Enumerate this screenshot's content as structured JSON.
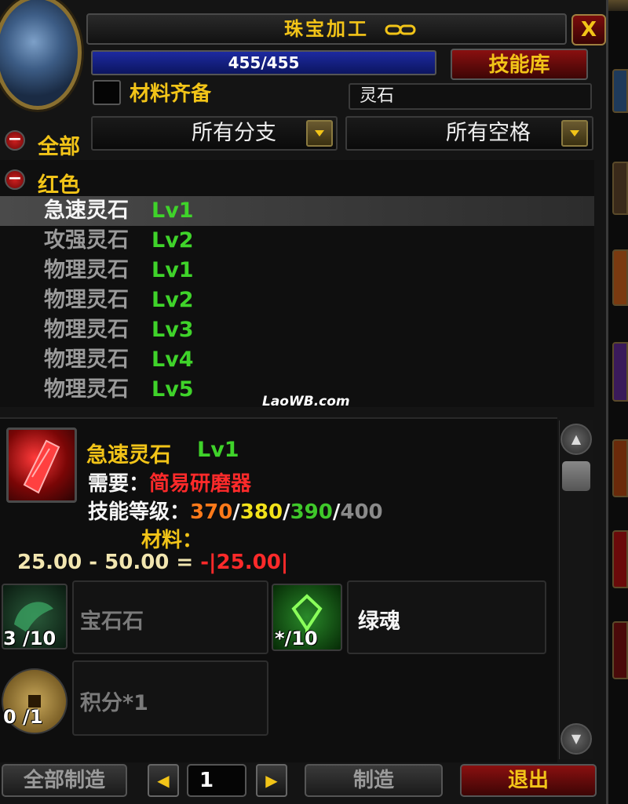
{
  "window": {
    "title": "珠宝加工",
    "close_label": "X",
    "skill_progress_text": "455/455",
    "skill_progress_fraction": 1.0,
    "skill_library_label": "技能库"
  },
  "filters": {
    "have_materials_label": "材料齐备",
    "search_value": "灵石",
    "subclass_dropdown": "所有分支",
    "slot_dropdown": "所有空格"
  },
  "list": {
    "categories": [
      {
        "label": "全部",
        "collapse_icon": "minus-icon"
      },
      {
        "label": "红色",
        "collapse_icon": "minus-icon"
      }
    ],
    "recipes": [
      {
        "name": "急速灵石",
        "lv": "Lv1",
        "name_color": "#f5f5f5",
        "selected": true
      },
      {
        "name": "攻强灵石",
        "lv": "Lv2",
        "name_color": "#9a9a9a",
        "selected": false
      },
      {
        "name": "物理灵石",
        "lv": "Lv1",
        "name_color": "#9a9a9a",
        "selected": false
      },
      {
        "name": "物理灵石",
        "lv": "Lv2",
        "name_color": "#9a9a9a",
        "selected": false
      },
      {
        "name": "物理灵石",
        "lv": "Lv3",
        "name_color": "#9a9a9a",
        "selected": false
      },
      {
        "name": "物理灵石",
        "lv": "Lv4",
        "name_color": "#9a9a9a",
        "selected": false
      },
      {
        "name": "物理灵石",
        "lv": "Lv5",
        "name_color": "#9a9a9a",
        "selected": false
      }
    ]
  },
  "watermark": "LaoWB.com",
  "detail": {
    "item_name": "急速灵石",
    "item_lv": "Lv1",
    "requires_label": "需要：",
    "requires_value": "简易研磨器",
    "skill_level_label": "技能等级：",
    "skill_levels": [
      "370",
      "380",
      "390",
      "400"
    ],
    "skill_level_colors": [
      "#ff7a1a",
      "#f2e21a",
      "#3fc82a",
      "#8a8a8a"
    ],
    "sep": "/",
    "materials_label": "材料：",
    "formula_a": "25.00 - 50.00 = ",
    "formula_b": "-|25.00|",
    "reagents": [
      {
        "name": "宝石石",
        "count": "3 /10",
        "icon": "dragon-gem-icon",
        "name_color": "#7a7a7a"
      },
      {
        "name": "绿魂",
        "count": "*/10",
        "icon": "green-soul-icon",
        "name_color": "#f5f5f5"
      },
      {
        "name": "积分*1",
        "count": "0 /1",
        "icon": "coin-icon",
        "name_color": "#7a7a7a"
      }
    ]
  },
  "bottom": {
    "create_all_label": "全部制造",
    "quantity_value": "1",
    "prev_arrow": "◀",
    "next_arrow": "▶",
    "create_label": "制造",
    "exit_label": "退出"
  },
  "colors": {
    "accent_gold": "#f2c418",
    "level_green": "#3fd32a",
    "requirement_red": "#ff2a2a"
  }
}
